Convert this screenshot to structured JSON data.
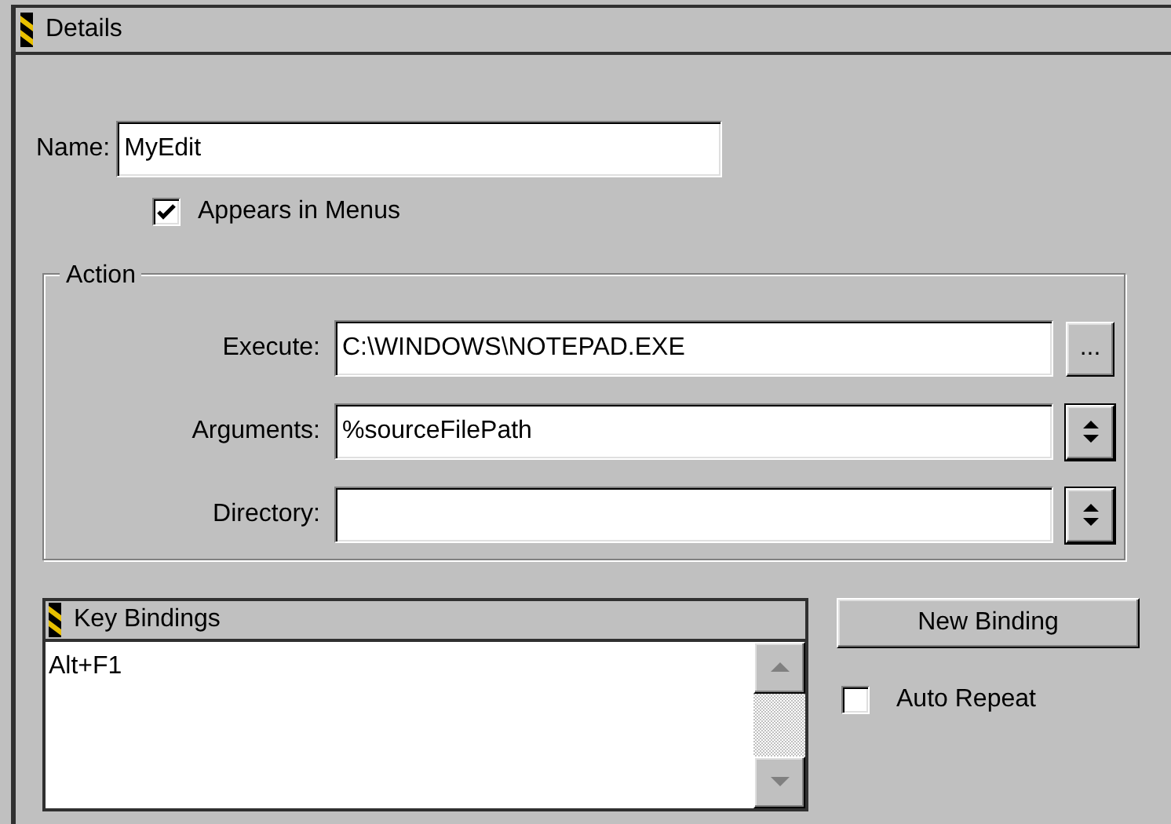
{
  "panel": {
    "title": "Details"
  },
  "name": {
    "label": "Name:",
    "value": "MyEdit"
  },
  "appears_in_menus": {
    "label": "Appears in Menus",
    "checked": true
  },
  "action": {
    "title": "Action",
    "fields": [
      {
        "label": "Execute:",
        "value": "C:\\WINDOWS\\NOTEPAD.EXE",
        "kind": "browse",
        "button": "..."
      },
      {
        "label": "Arguments:",
        "value": "%sourceFilePath",
        "kind": "spinner"
      },
      {
        "label": "Directory:",
        "kind": "spinner"
      }
    ]
  },
  "key_bindings": {
    "title": "Key Bindings",
    "items": [
      {
        "label": "Alt+F1"
      }
    ]
  },
  "new_binding_button": "New Binding",
  "auto_repeat": {
    "label": "Auto Repeat",
    "checked": false
  }
}
